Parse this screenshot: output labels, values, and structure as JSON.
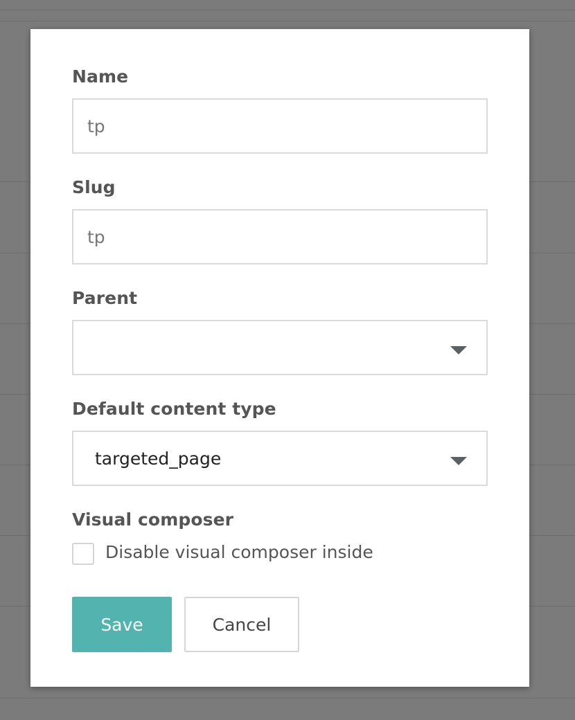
{
  "form": {
    "name": {
      "label": "Name",
      "value": "tp"
    },
    "slug": {
      "label": "Slug",
      "value": "tp"
    },
    "parent": {
      "label": "Parent",
      "selected": ""
    },
    "default_content_type": {
      "label": "Default content type",
      "selected": "targeted_page"
    },
    "visual_composer": {
      "label": "Visual composer",
      "checkbox_label": "Disable visual composer inside",
      "checked": false
    }
  },
  "buttons": {
    "save": "Save",
    "cancel": "Cancel"
  },
  "icons": {
    "select_caret": "chevron-down-icon"
  },
  "colors": {
    "primary": "#52b3af",
    "backdrop": "#7b7b7b",
    "label": "#555555",
    "border": "#dadada"
  }
}
